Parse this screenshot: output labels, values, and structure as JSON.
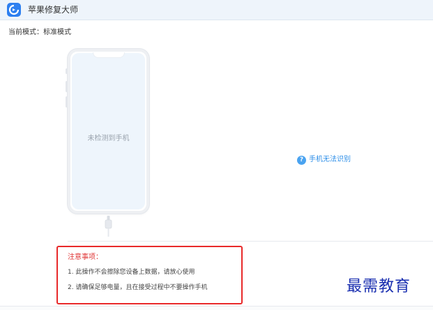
{
  "app": {
    "title": "苹果修复大师"
  },
  "mode": {
    "label": "当前模式：标准模式"
  },
  "device": {
    "status_text": "未检测到手机"
  },
  "help": {
    "icon_glyph": "?",
    "link_text": "手机无法识别"
  },
  "notice": {
    "title": "注意事项：",
    "items": [
      "1. 此操作不会擦除您设备上数据，请放心使用",
      "2. 请确保足够电量，且在接受过程中不要操作手机"
    ]
  },
  "watermark": {
    "text": "最需教育"
  },
  "colors": {
    "accent": "#2c8ee8",
    "notice_border": "#e8292a",
    "watermark": "#1a2fb0"
  }
}
